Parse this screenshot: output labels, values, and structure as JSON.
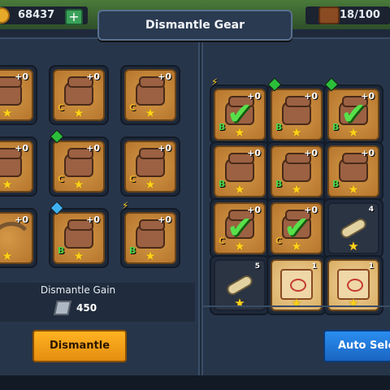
{
  "topbar": {
    "gold": "68437",
    "plus_symbol": "+",
    "inventory": "18/100"
  },
  "title": "Dismantle Gear",
  "left_grid": {
    "slots": [
      {
        "item": "armor",
        "level": "+0",
        "grade": "",
        "marker": ""
      },
      {
        "item": "glove",
        "level": "+0",
        "grade": "C",
        "marker": ""
      },
      {
        "item": "glove",
        "level": "+0",
        "grade": "C",
        "marker": ""
      },
      {
        "item": "glove",
        "level": "+0",
        "grade": "",
        "marker": ""
      },
      {
        "item": "glove",
        "level": "+0",
        "grade": "C",
        "marker": "green-gem-icon"
      },
      {
        "item": "glove",
        "level": "+0",
        "grade": "C",
        "marker": ""
      },
      {
        "item": "bow",
        "level": "+0",
        "grade": "",
        "marker": ""
      },
      {
        "item": "glove",
        "level": "+0",
        "grade": "B",
        "marker": "blue-gem-icon"
      },
      {
        "item": "glove",
        "level": "+0",
        "grade": "B",
        "marker": "lightning-icon"
      }
    ]
  },
  "dismantle_gain": {
    "label": "Dismantle Gain",
    "value": "450",
    "icon": "ore-icon"
  },
  "right_grid": {
    "slots": [
      {
        "item": "glove",
        "level": "+0",
        "grade": "B",
        "checked": true,
        "marker": "lightning-icon"
      },
      {
        "item": "glove",
        "level": "+0",
        "grade": "B",
        "checked": false,
        "marker": "green-gem-icon"
      },
      {
        "item": "glove",
        "level": "+0",
        "grade": "B",
        "checked": true,
        "marker": "green-gem-icon"
      },
      {
        "item": "glove",
        "level": "+0",
        "grade": "B",
        "checked": false,
        "marker": ""
      },
      {
        "item": "glove",
        "level": "+0",
        "grade": "B",
        "checked": false,
        "marker": ""
      },
      {
        "item": "glove",
        "level": "+0",
        "grade": "B",
        "checked": false,
        "marker": ""
      },
      {
        "item": "glove",
        "level": "+0",
        "grade": "C",
        "checked": true,
        "marker": ""
      },
      {
        "item": "glove",
        "level": "+0",
        "grade": "C",
        "checked": true,
        "marker": ""
      },
      {
        "item": "tube",
        "count": "4",
        "checked": false,
        "marker": ""
      },
      {
        "item": "tube",
        "count": "5",
        "checked": false,
        "marker": ""
      },
      {
        "item": "scroll",
        "count": "1",
        "checked": false,
        "marker": ""
      },
      {
        "item": "scroll",
        "count": "1",
        "checked": false,
        "marker": ""
      }
    ]
  },
  "buttons": {
    "dismantle": "Dismantle",
    "auto_select": "Auto Sele"
  },
  "colors": {
    "dismantle_button": "#f5a01c",
    "auto_select_button": "#2a8ef0",
    "check_mark": "#58e04a",
    "star": "#ffd21a"
  }
}
